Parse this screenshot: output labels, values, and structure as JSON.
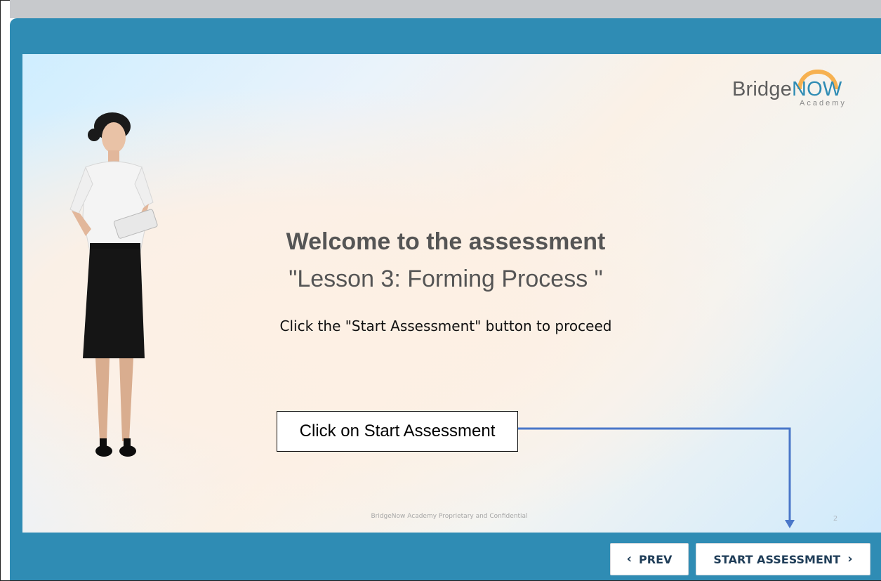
{
  "slide": {
    "title": "Welcome to the assessment",
    "subtitle": "\"Lesson 3: Forming Process \"",
    "instruction": "Click the \"Start Assessment\" button to proceed",
    "footer": "BridgeNow Academy Proprietary and Confidential",
    "page_number": "2"
  },
  "logo": {
    "brand_part1": "Bridge",
    "brand_part2": "NOW",
    "sub": "Academy"
  },
  "callout": {
    "text": "Click on Start Assessment"
  },
  "nav": {
    "prev_label": "PREV",
    "start_label": "START ASSESSMENT",
    "prev_icon": "chevron-left-icon",
    "next_icon": "chevron-right-icon"
  },
  "colors": {
    "player_frame": "#2f8cb4",
    "button_text": "#1f3d58",
    "callout_arrow": "#4a77c9",
    "logo_accent": "#f7a635"
  }
}
